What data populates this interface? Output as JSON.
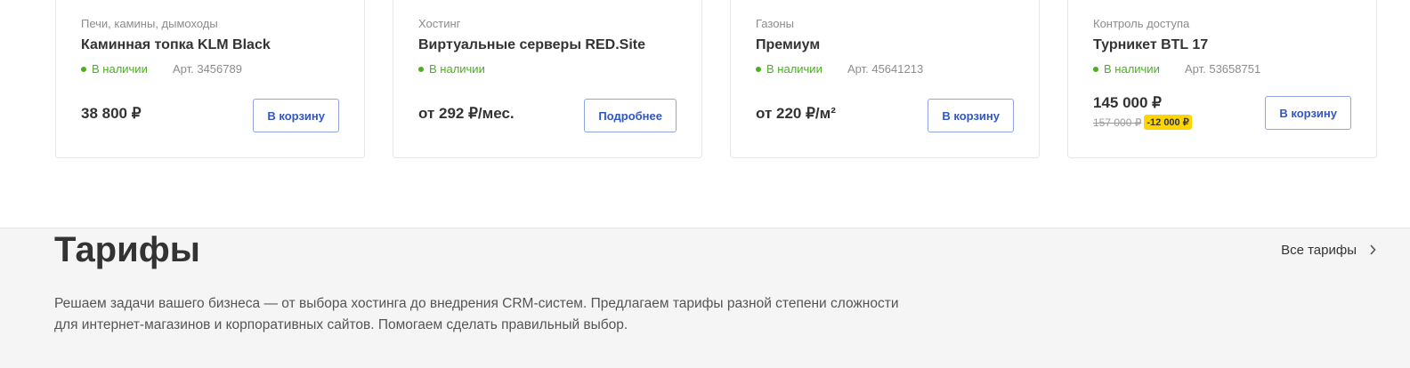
{
  "products": [
    {
      "category": "Печи, камины, дымоходы",
      "name": "Каминная топка KLM Black",
      "stock": "В наличии",
      "article": "Арт. 3456789",
      "price": "38 800 ₽",
      "button": "В корзину"
    },
    {
      "category": "Хостинг",
      "name": "Виртуальные серверы RED.Site",
      "stock": "В наличии",
      "article": "",
      "price": "от 292 ₽/мес.",
      "button": "Подробнее"
    },
    {
      "category": "Газоны",
      "name": "Премиум",
      "stock": "В наличии",
      "article": "Арт. 45641213",
      "price": "от 220 ₽/м²",
      "button": "В корзину"
    },
    {
      "category": "Контроль доступа",
      "name": "Турникет BTL 17",
      "stock": "В наличии",
      "article": "Арт. 53658751",
      "price": "145 000 ₽",
      "old_price": "157 000 ₽",
      "discount": "-12 000 ₽",
      "button": "В корзину"
    }
  ],
  "tariffs": {
    "title": "Тарифы",
    "all_link": "Все тарифы",
    "description": "Решаем задачи вашего бизнеса — от выбора хостинга до внедрения CRM-систем. Предлагаем тарифы разной степени сложности для интернет-магазинов и корпоративных сайтов. Помогаем сделать правильный выбор."
  },
  "colors": {
    "accent": "#3256c4",
    "in_stock": "#4caf20",
    "discount_badge": "#ffd500",
    "section_bg": "#f5f5f5"
  },
  "icons": {
    "chevron": "chevron-right-icon"
  }
}
